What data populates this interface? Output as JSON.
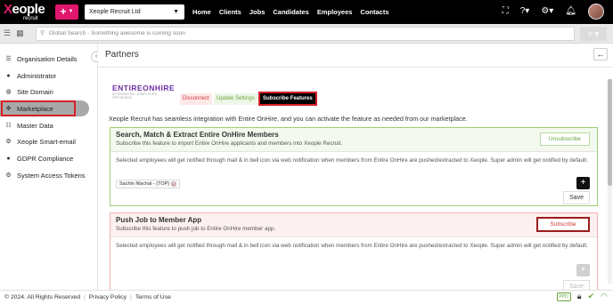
{
  "brand": {
    "name_x": "X",
    "name_rest": "eople",
    "sub": "recruit",
    "accent": "#e0176c"
  },
  "topbar": {
    "plus": "+",
    "company": "Xeople Recruit Ltd",
    "nav": [
      "Home",
      "Clients",
      "Jobs",
      "Candidates",
      "Employees",
      "Contacts"
    ]
  },
  "search": {
    "placeholder": "Global Search - Something awesome is coming soon",
    "plus": "+"
  },
  "sidebar": {
    "items": [
      {
        "label": "Organisation Details",
        "icon": "list-icon"
      },
      {
        "label": "Administrator",
        "icon": "user-icon"
      },
      {
        "label": "Site Domain",
        "icon": "globe-icon"
      },
      {
        "label": "Marketplace",
        "icon": "marketplace-icon"
      },
      {
        "label": "Master Data",
        "icon": "database-icon"
      },
      {
        "label": "Xeople Smart-email",
        "icon": "gear-icon"
      },
      {
        "label": "GDPR Compliance",
        "icon": "user-shield-icon"
      },
      {
        "label": "System Access Tokens",
        "icon": "cog-icon"
      }
    ]
  },
  "main": {
    "title": "Partners",
    "partner": {
      "name": "ENTIREONHIRE",
      "tagline": "INTEGRATED. SIMPLIFIED. OPTIMISED."
    },
    "buttons": {
      "disconnect": "Disconnect",
      "update": "Update Settings",
      "subscribe_features": "Subscribe Features"
    },
    "intro": "Xeople Recruit has seamless integration with Entire OnHire, and you can activate the feature as needed from our marketplace.",
    "cards": [
      {
        "title": "Search, Match & Extract Entire OnHire Members",
        "desc": "Subscribe this feature to import Entire OnHire applicants and members into Xeople Recruit.",
        "action": "Unsubscribe",
        "note": "Selected employees will get notified through mail & in bell icon via web notification when members from Entire OnHire are pushed/extracted to Xeople. Super admin will get notified by default.",
        "chip": "Sachin Nischal - (TOP)",
        "save": "Save"
      },
      {
        "title": "Push Job to Member App",
        "desc": "Subscribe this feature to push job to Entire OnHire member app.",
        "action": "Subscribe",
        "note": "Selected employees will get notified through mail & in bell icon via web notification when members from Entire OnHire are pushed/extracted to Xeople. Super admin will get notified by default.",
        "save": "Save"
      }
    ]
  },
  "footer": {
    "copyright": "© 2024. All Rights Reserved",
    "privacy": "Privacy Policy",
    "terms": "Terms of Use",
    "ppd": "PPD"
  }
}
